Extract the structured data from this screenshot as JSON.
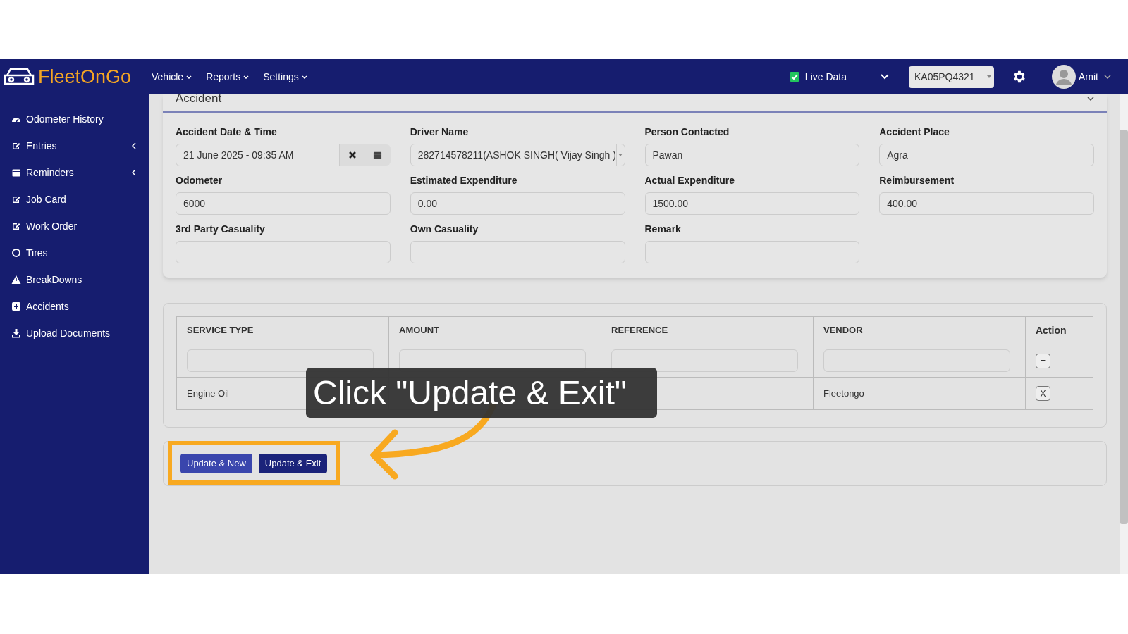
{
  "navbar": {
    "logo": "FleetOnGo",
    "menus": [
      {
        "label": "Vehicle"
      },
      {
        "label": "Reports"
      },
      {
        "label": "Settings"
      }
    ],
    "live_data": {
      "label": "Live Data",
      "checked": true
    },
    "vehicle_select": "KA05PQ4321",
    "user": "Amit"
  },
  "sidebar": {
    "items": [
      {
        "label": "Odometer History",
        "has_submenu": false
      },
      {
        "label": "Entries",
        "has_submenu": true
      },
      {
        "label": "Reminders",
        "has_submenu": true
      },
      {
        "label": "Job Card",
        "has_submenu": false
      },
      {
        "label": "Work Order",
        "has_submenu": false
      },
      {
        "label": "Tires",
        "has_submenu": false
      },
      {
        "label": "BreakDowns",
        "has_submenu": false
      },
      {
        "label": "Accidents",
        "has_submenu": false
      },
      {
        "label": "Upload Documents",
        "has_submenu": false
      }
    ]
  },
  "section_title": "Accident",
  "fields": [
    {
      "label": "Accident Date & Time",
      "value": "21 June 2025 - 09:35 AM",
      "kind": "date"
    },
    {
      "label": "Driver Name",
      "value": "282714578211(ASHOK SINGH( Vijay Singh )",
      "kind": "select"
    },
    {
      "label": "Person Contacted",
      "value": "Pawan",
      "kind": "text"
    },
    {
      "label": "Accident Place",
      "value": "Agra",
      "kind": "text"
    },
    {
      "label": "Odometer",
      "value": "6000",
      "kind": "text"
    },
    {
      "label": "Estimated Expenditure",
      "value": "0.00",
      "kind": "text"
    },
    {
      "label": "Actual Expenditure",
      "value": "1500.00",
      "kind": "text"
    },
    {
      "label": "Reimbursement",
      "value": "400.00",
      "kind": "text"
    },
    {
      "label": "3rd Party Casuality",
      "kind": "text"
    },
    {
      "label": "Own Casuality",
      "kind": "text"
    },
    {
      "label": "Remark",
      "kind": "text"
    }
  ],
  "table": {
    "columns": [
      "SERVICE TYPE",
      "AMOUNT",
      "REFERENCE",
      "VENDOR",
      "Action"
    ],
    "add_button": "+",
    "rows": [
      {
        "service_type": "Engine Oil",
        "vendor": "Fleetongo",
        "delete": "X"
      }
    ]
  },
  "buttons": [
    {
      "label": "Update & New",
      "kind": "secondary"
    },
    {
      "label": "Update & Exit",
      "kind": "primary"
    }
  ],
  "callout": "Click \"Update & Exit\""
}
